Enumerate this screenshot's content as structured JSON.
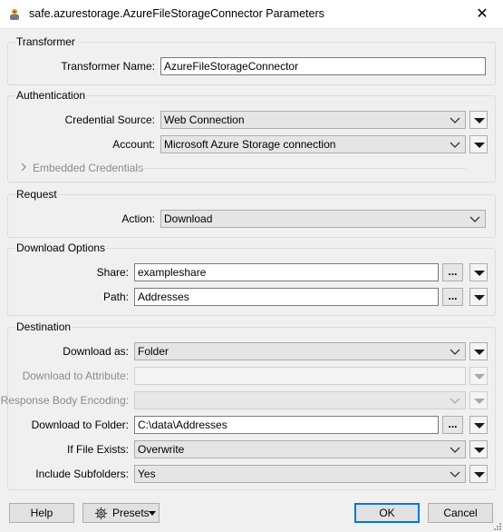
{
  "window": {
    "title": "safe.azurestorage.AzureFileStorageConnector Parameters",
    "close_glyph": "✕"
  },
  "transformer": {
    "group_title": "Transformer",
    "name_label": "Transformer Name:",
    "name_value": "AzureFileStorageConnector"
  },
  "authentication": {
    "group_title": "Authentication",
    "credential_source_label": "Credential Source:",
    "credential_source_value": "Web Connection",
    "account_label": "Account:",
    "account_value": "Microsoft Azure Storage connection",
    "embedded_label": "Embedded Credentials"
  },
  "request": {
    "group_title": "Request",
    "action_label": "Action:",
    "action_value": "Download"
  },
  "download_options": {
    "group_title": "Download Options",
    "share_label": "Share:",
    "share_value": "exampleshare",
    "path_label": "Path:",
    "path_value": "Addresses",
    "browse_glyph": "..."
  },
  "destination": {
    "group_title": "Destination",
    "download_as_label": "Download as:",
    "download_as_value": "Folder",
    "download_to_attribute_label": "Download to Attribute:",
    "download_to_attribute_value": "",
    "response_body_encoding_label": "Response Body Encoding:",
    "response_body_encoding_value": "",
    "download_to_folder_label": "Download to Folder:",
    "download_to_folder_value": "C:\\data\\Addresses",
    "if_file_exists_label": "If File Exists:",
    "if_file_exists_value": "Overwrite",
    "include_subfolders_label": "Include Subfolders:",
    "include_subfolders_value": "Yes"
  },
  "footer": {
    "help_label": "Help",
    "presets_label": "Presets",
    "ok_label": "OK",
    "cancel_label": "Cancel"
  },
  "colors": {
    "focus_border": "#0078d7",
    "disabled_text": "#8a8a8a"
  }
}
